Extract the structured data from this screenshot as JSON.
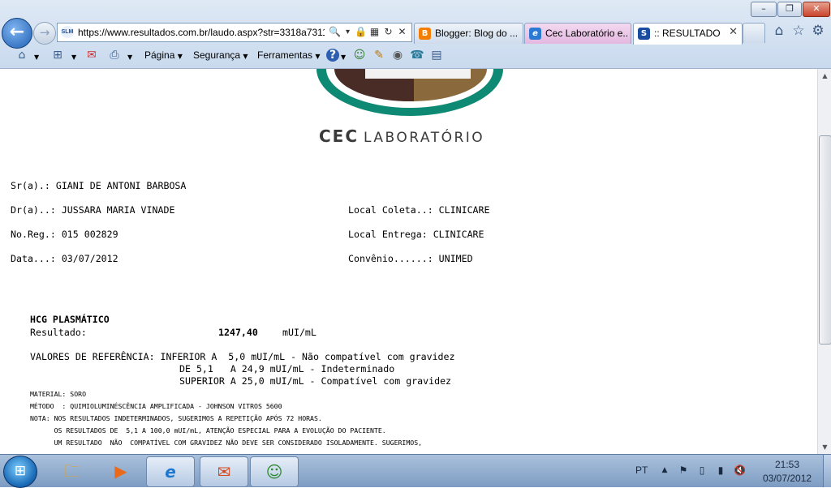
{
  "browser": {
    "window_controls": {
      "minimize": "–",
      "maximize": "❐",
      "close": "✕"
    },
    "address": {
      "badge": "SLM",
      "url": "https://www.resultados.com.br/laudo.aspx?str=3318a7311",
      "search_icon": "🔍",
      "dropdown_icon": "▾",
      "lock_icon": "🔒",
      "compat_icon": "▦",
      "refresh_icon": "↻",
      "stop_icon": "✕"
    },
    "tabs": [
      {
        "label": "Blogger: Blog do ...",
        "icon": "B",
        "color": "#f57d00"
      },
      {
        "label": "Cec Laboratório e...",
        "icon": "e",
        "color": "#2a7ad4"
      },
      {
        "label": ":: RESULTADO ...",
        "icon": "S",
        "color": "#1a4da0",
        "close": "✕"
      }
    ],
    "right_tools": {
      "home": "⌂",
      "favorites": "☆",
      "settings": "⚙"
    },
    "command_bar": {
      "home_icon": "⌂",
      "feeds_icon": "⊞",
      "mail_icon": "✉",
      "print_icon": "⎙",
      "pagina": "Página",
      "seguranca": "Segurança",
      "ferramentas": "Ferramentas",
      "help_icon": "?",
      "extra_icons": [
        "☺",
        "✎",
        "◉",
        "☎",
        "▤"
      ]
    }
  },
  "report": {
    "lab_name_bold": "CEC",
    "lab_name_rest": "LABORATÓRIO",
    "patient_line": "Sr(a).: GIANI DE ANTONI BARBOSA",
    "doctor_line": "Dr(a)..: JUSSARA MARIA VINADE",
    "local_coleta_line": "Local Coleta..: CLINICARE",
    "reg_line": "No.Reg.: 015 002829",
    "local_entrega_line": "Local Entrega: CLINICARE",
    "date_line": "Data...: 03/07/2012",
    "convenio_line": "Convênio......: UNIMED",
    "exam_title": "HCG PLASMÁTICO",
    "result_label": "Resultado:",
    "result_value": "1247,40",
    "result_unit": "mUI/mL",
    "ref_line_1": "VALORES DE REFERÊNCIA: INFERIOR A  5,0 mUI/mL - Não compatível com gravidez",
    "ref_line_2": "DE 5,1   A 24,9 mUI/mL - Indeterminado",
    "ref_line_3": "SUPERIOR A 25,0 mUI/mL - Compatível com gravidez",
    "material": "MATERIAL: SORO",
    "metodo": "MÉTODO  : QUIMIOLUMINÉSCÊNCIA AMPLIFICADA - JOHNSON VITROS 5600",
    "nota_1": "NOTA: NOS RESULTADOS INDETERMINADOS, SUGERIMOS A REPETIÇÃO APÓS 72 HORAS.",
    "nota_2": "      OS RESULTADOS DE  5,1 A 100,0 mUI/mL, ATENÇÃO ESPECIAL PARA A EVOLUÇÃO DO PACIENTE.",
    "nota_3": "      UM RESULTADO  NÃO  COMPATÍVEL COM GRAVIDEZ NÃO DEVE SER CONSIDERADO ISOLADAMENTE. SUGERIMOS,"
  },
  "scrollbar": {
    "up": "▲",
    "down": "▼"
  },
  "taskbar": {
    "start_icon": "⊞",
    "apps": [
      {
        "icon": "🗀",
        "color": "#e8b64a"
      },
      {
        "icon": "▶",
        "color": "#e86a1a"
      },
      {
        "icon": "e",
        "color": "#1e78d0"
      },
      {
        "icon": "✉",
        "color": "#d24a1e"
      },
      {
        "icon": "☺",
        "color": "#2f8a2f"
      }
    ],
    "language": "PT",
    "tray_icons": [
      "▲",
      "⚑",
      "▯",
      "▮",
      "🔇"
    ],
    "time": "21:53",
    "date": "03/07/2012"
  }
}
